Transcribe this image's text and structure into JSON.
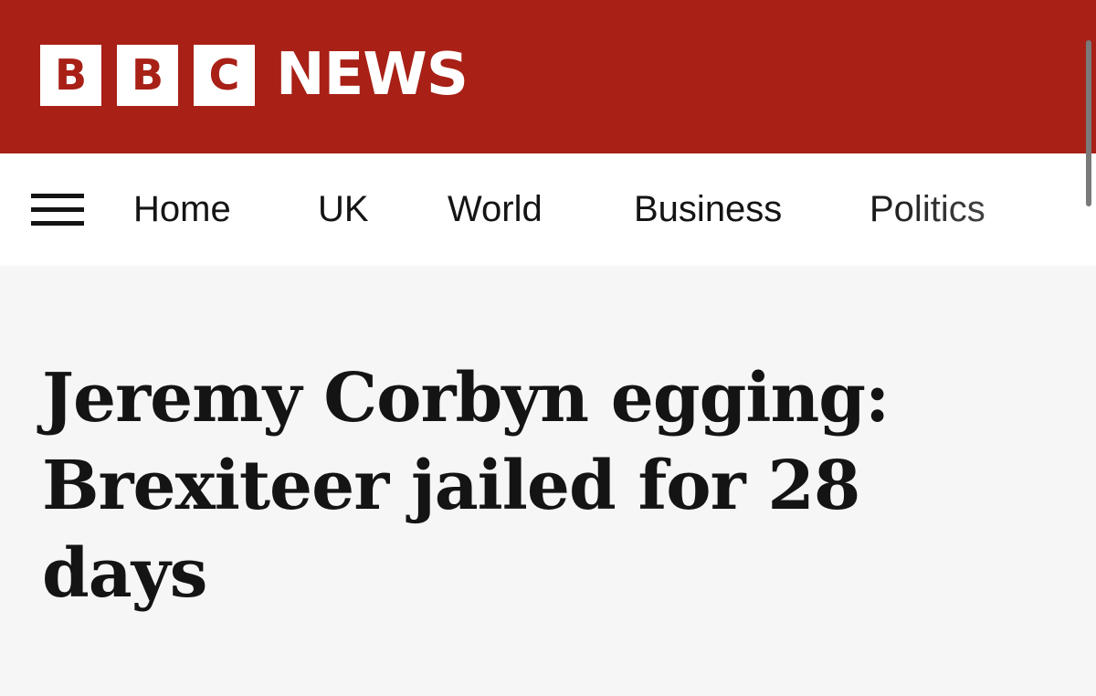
{
  "masthead": {
    "logo_letters": [
      "B",
      "B",
      "C"
    ],
    "brand_word": "NEWS",
    "background_color": "#a82016"
  },
  "nav": {
    "menu_icon": "hamburger-menu-icon",
    "items": [
      {
        "label": "Home"
      },
      {
        "label": "UK"
      },
      {
        "label": "World"
      },
      {
        "label": "Business"
      },
      {
        "label": "Politics"
      }
    ]
  },
  "article": {
    "headline": "Jeremy Corbyn egging: Brexiteer jailed for 28 days"
  }
}
